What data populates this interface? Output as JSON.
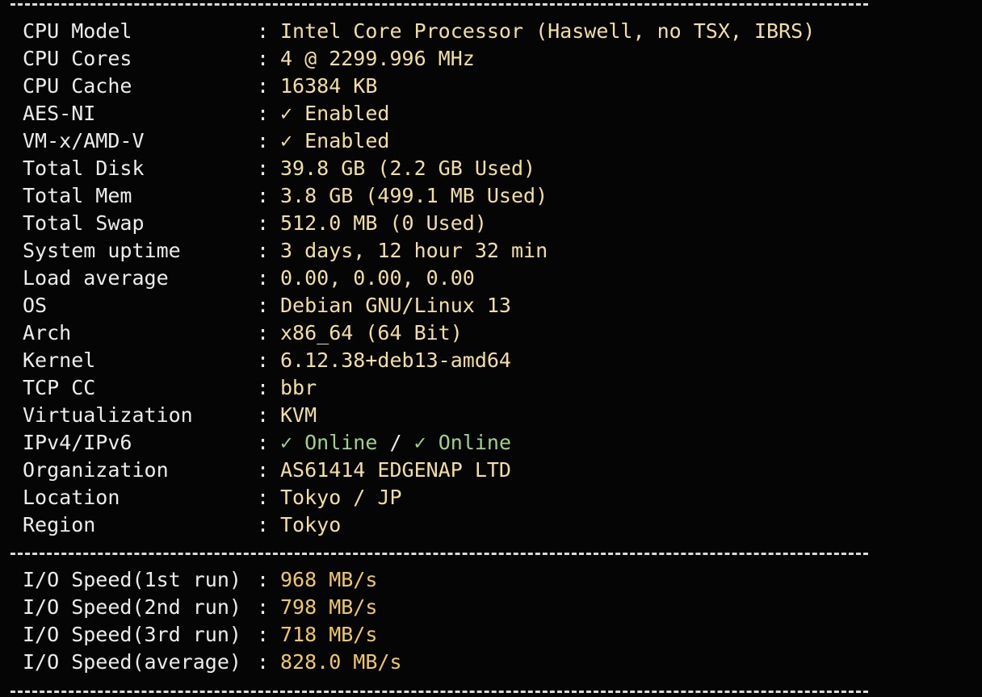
{
  "separator": "------------------------------------------------------------------------------------",
  "system_info": [
    {
      "label": "CPU Model",
      "value": "Intel Core Processor (Haswell, no TSX, IBRS)"
    },
    {
      "label": "CPU Cores",
      "value": "4 @ 2299.996 MHz"
    },
    {
      "label": "CPU Cache",
      "value": "16384 KB"
    },
    {
      "label": "AES-NI",
      "value": "✓ Enabled"
    },
    {
      "label": "VM-x/AMD-V",
      "value": "✓ Enabled"
    },
    {
      "label": "Total Disk",
      "value": "39.8 GB (2.2 GB Used)"
    },
    {
      "label": "Total Mem",
      "value": "3.8 GB (499.1 MB Used)"
    },
    {
      "label": "Total Swap",
      "value": "512.0 MB (0 Used)"
    },
    {
      "label": "System uptime",
      "value": "3 days, 12 hour 32 min"
    },
    {
      "label": "Load average",
      "value": "0.00, 0.00, 0.00"
    },
    {
      "label": "OS",
      "value": "Debian GNU/Linux 13"
    },
    {
      "label": "Arch",
      "value": "x86_64 (64 Bit)"
    },
    {
      "label": "Kernel",
      "value": "6.12.38+deb13-amd64"
    },
    {
      "label": "TCP CC",
      "value": "bbr"
    },
    {
      "label": "Virtualization",
      "value": "KVM"
    },
    {
      "label": "IPv4/IPv6",
      "ipv4": "✓ Online",
      "divider": "/",
      "ipv6": "✓ Online"
    },
    {
      "label": "Organization",
      "value": "AS61414 EDGENAP LTD"
    },
    {
      "label": "Location",
      "value": "Tokyo / JP"
    },
    {
      "label": "Region",
      "value": "Tokyo"
    }
  ],
  "colon": ":",
  "io_speed": [
    {
      "label": "I/O Speed(1st run)",
      "value": "968 MB/s"
    },
    {
      "label": "I/O Speed(2nd run)",
      "value": "798 MB/s"
    },
    {
      "label": "I/O Speed(3rd run)",
      "value": "718 MB/s"
    },
    {
      "label": "I/O Speed(average)",
      "value": "828.0 MB/s"
    }
  ],
  "colors": {
    "background": "#050505",
    "label": "#ececec",
    "value": "#f3df9f",
    "io_value": "#f1c960",
    "online": "#9ed28b"
  }
}
